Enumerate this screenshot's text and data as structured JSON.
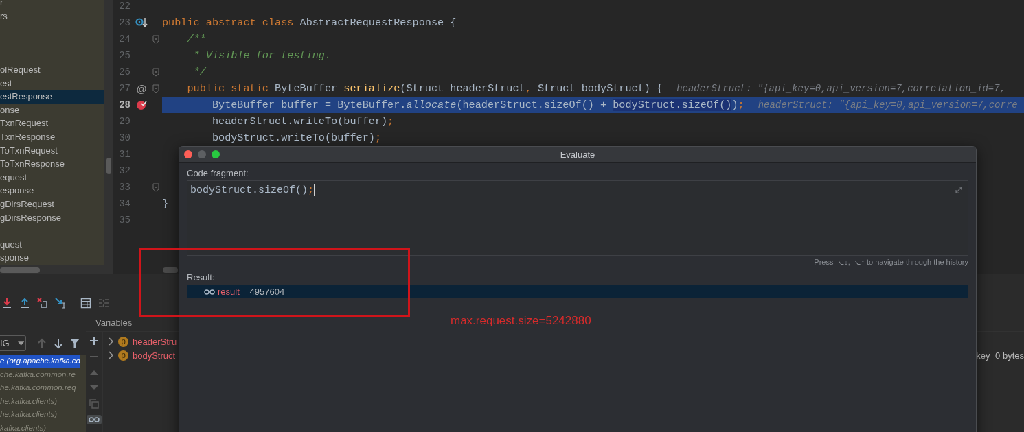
{
  "project_tree": {
    "items": [
      {
        "kind": "file",
        "label": "r",
        "selected": false
      },
      {
        "kind": "file",
        "label": "rs",
        "selected": false
      },
      {
        "kind": "blank"
      },
      {
        "kind": "blank"
      },
      {
        "kind": "blank"
      },
      {
        "kind": "file",
        "label": "olRequest",
        "selected": false
      },
      {
        "kind": "file",
        "label": "est",
        "selected": false
      },
      {
        "kind": "file",
        "label": "estResponse",
        "selected": true
      },
      {
        "kind": "file",
        "label": "onse",
        "selected": false
      },
      {
        "kind": "file",
        "label": "TxnRequest",
        "selected": false
      },
      {
        "kind": "file",
        "label": "TxnResponse",
        "selected": false
      },
      {
        "kind": "file",
        "label": "ToTxnRequest",
        "selected": false
      },
      {
        "kind": "file",
        "label": "ToTxnResponse",
        "selected": false
      },
      {
        "kind": "file",
        "label": "equest",
        "selected": false
      },
      {
        "kind": "file",
        "label": "esponse",
        "selected": false
      },
      {
        "kind": "file",
        "label": "gDirsRequest",
        "selected": false
      },
      {
        "kind": "file",
        "label": "gDirsResponse",
        "selected": false
      },
      {
        "kind": "blank"
      },
      {
        "kind": "file",
        "label": "quest",
        "selected": false
      },
      {
        "kind": "file",
        "label": "sponse",
        "selected": false
      }
    ]
  },
  "editor": {
    "lines": [
      {
        "number": "22",
        "selected": false,
        "fold": false
      },
      {
        "number": "23",
        "selected": false,
        "fold": false,
        "marker": {
          "kind": "override"
        },
        "tokens": [
          {
            "kind": "keyword",
            "text": "public abstract class "
          },
          {
            "kind": "plain",
            "text": "AbstractRequestResponse {"
          }
        ]
      },
      {
        "number": "24",
        "selected": false,
        "fold": true,
        "tokens": [
          {
            "kind": "comment",
            "text": "    /**"
          }
        ]
      },
      {
        "number": "25",
        "selected": false,
        "fold": false,
        "tokens": [
          {
            "kind": "comment",
            "text": "     * Visible for testing."
          }
        ]
      },
      {
        "number": "26",
        "selected": false,
        "fold": true,
        "tokens": [
          {
            "kind": "comment",
            "text": "     */"
          }
        ]
      },
      {
        "number": "27",
        "selected": false,
        "fold": true,
        "marker": {
          "kind": "symbol",
          "text": "@"
        },
        "tokens": [
          {
            "kind": "keyword",
            "text": "    public static "
          },
          {
            "kind": "plain",
            "text": "ByteBuffer "
          },
          {
            "kind": "method",
            "text": "serialize"
          },
          {
            "kind": "plain",
            "text": "(Struct headerStruct"
          },
          {
            "kind": "keyword",
            "text": ", "
          },
          {
            "kind": "plain",
            "text": "Struct bodyStruct) {"
          },
          {
            "kind": "hint",
            "text": "headerStruct: \"{api_key=0,api_version=7,correlation_id=7,"
          }
        ]
      },
      {
        "number": "28",
        "selected": true,
        "fold": false,
        "marker": {
          "kind": "breakpoint"
        },
        "tokens": [
          {
            "kind": "plain",
            "text": "        ByteBuffer buffer = ByteBuffer."
          },
          {
            "kind": "italic",
            "text": "allocate"
          },
          {
            "kind": "plain",
            "text": "(headerStruct.sizeOf() + "
          },
          {
            "kind": "selection",
            "text": "bodyStruct.sizeOf()"
          },
          {
            "kind": "plain",
            "text": ")"
          },
          {
            "kind": "keyword",
            "text": ";"
          },
          {
            "kind": "hint",
            "text": "headerStruct: \"{api_key=0,api_version=7,corre"
          }
        ]
      },
      {
        "number": "29",
        "selected": false,
        "fold": false,
        "tokens": [
          {
            "kind": "plain",
            "text": "        headerStruct.writeTo(buffer)"
          },
          {
            "kind": "keyword",
            "text": ";"
          }
        ]
      },
      {
        "number": "30",
        "selected": false,
        "fold": false,
        "tokens": [
          {
            "kind": "plain",
            "text": "        bodyStruct.writeTo(buffer)"
          },
          {
            "kind": "keyword",
            "text": ";"
          }
        ]
      },
      {
        "number": "31",
        "selected": false,
        "fold": false
      },
      {
        "number": "32",
        "selected": false,
        "fold": false
      },
      {
        "number": "33",
        "selected": false,
        "fold": true
      },
      {
        "number": "34",
        "selected": false,
        "fold": false,
        "tokens": [
          {
            "kind": "plain",
            "text": "}"
          }
        ]
      },
      {
        "number": "35",
        "selected": false,
        "fold": false
      }
    ]
  },
  "debug": {
    "frames": {
      "filter": "IG",
      "items": [
        {
          "label": "e (org.apache.kafka.co",
          "selected": true
        },
        {
          "label": "che.kafka.common.re",
          "selected": false
        },
        {
          "label": "he.kafka.common.req",
          "selected": false
        },
        {
          "label": "he.kafka.clients)",
          "selected": false
        },
        {
          "label": "he.kafka.clients)",
          "selected": false
        },
        {
          "label": "kafka.clients)",
          "selected": false
        }
      ]
    },
    "variables": {
      "title": "Variables",
      "items": [
        {
          "badge": "p",
          "name": "headerStru"
        },
        {
          "badge": "p",
          "name": "bodyStruct",
          "value": "key=0 bytes"
        }
      ]
    }
  },
  "evaluate_dialog": {
    "title": "Evaluate",
    "fragment_label": "Code fragment:",
    "code": [
      {
        "kind": "plain",
        "text": "bodyStruct.sizeOf()"
      },
      {
        "kind": "keyword",
        "text": ";"
      }
    ],
    "history_hint": "Press ⌥↓, ⌥↑ to navigate through the history",
    "result_label": "Result:",
    "result": {
      "name": "result",
      "operator": "=",
      "value": "4957604"
    }
  },
  "annotation": {
    "text": "max.request.size=5242880"
  }
}
